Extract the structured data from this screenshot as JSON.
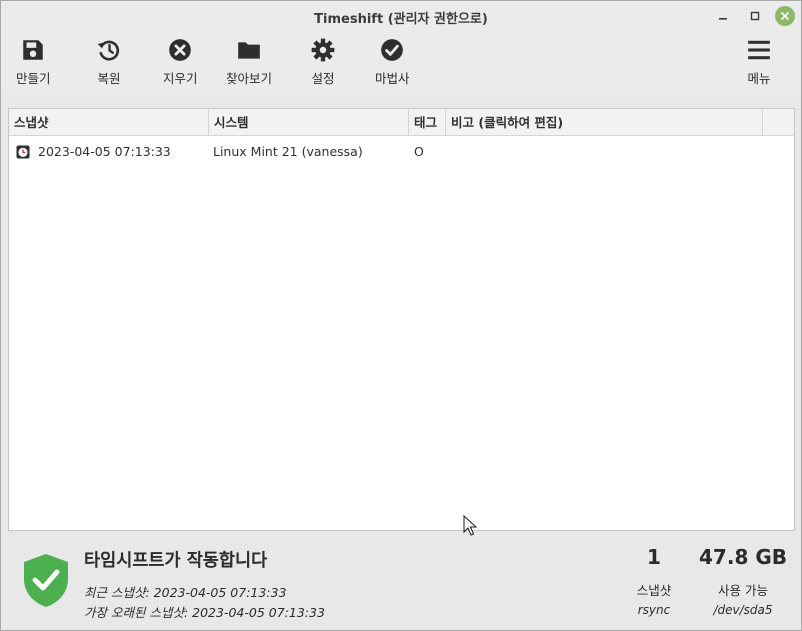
{
  "window": {
    "title": "Timeshift (관리자 권한으로)",
    "controls": {
      "minimize": "_",
      "maximize": "□",
      "close": "✕"
    }
  },
  "toolbar": {
    "buttons": [
      {
        "label": "만들기",
        "icon": "save-icon"
      },
      {
        "label": "복원",
        "icon": "history-icon"
      },
      {
        "label": "지우기",
        "icon": "delete-circle-icon"
      },
      {
        "label": "찾아보기",
        "icon": "folder-icon"
      },
      {
        "label": "설정",
        "icon": "gear-icon"
      },
      {
        "label": "마법사",
        "icon": "check-circle-icon"
      }
    ],
    "menu": {
      "label": "메뉴",
      "icon": "hamburger-menu-icon"
    }
  },
  "snapshot_table": {
    "columns": [
      "스냅샷",
      "시스템",
      "태그",
      "비고 (클릭하여 편집)"
    ],
    "rows": [
      {
        "snapshot": "2023-04-05 07:13:33",
        "system": "Linux Mint 21 (vanessa)",
        "tags": "O",
        "comment": ""
      }
    ]
  },
  "status": {
    "title": "타임시프트가 작동합니다",
    "latest_label": "최근 스냅샷:",
    "latest_value": "2023-04-05 07:13:33",
    "oldest_label": "가장 오래된 스냅샷:",
    "oldest_value": "2023-04-05 07:13:33",
    "snapshot_count": "1",
    "snapshot_count_label": "스냅샷",
    "snapshot_type": "rsync",
    "available_space": "47.8 GB",
    "available_label": "사용 가능",
    "device": "/dev/sda5"
  },
  "colors": {
    "shield": "#4caf50",
    "window_close": "#8fb76a",
    "background": "#e8e8e8"
  }
}
